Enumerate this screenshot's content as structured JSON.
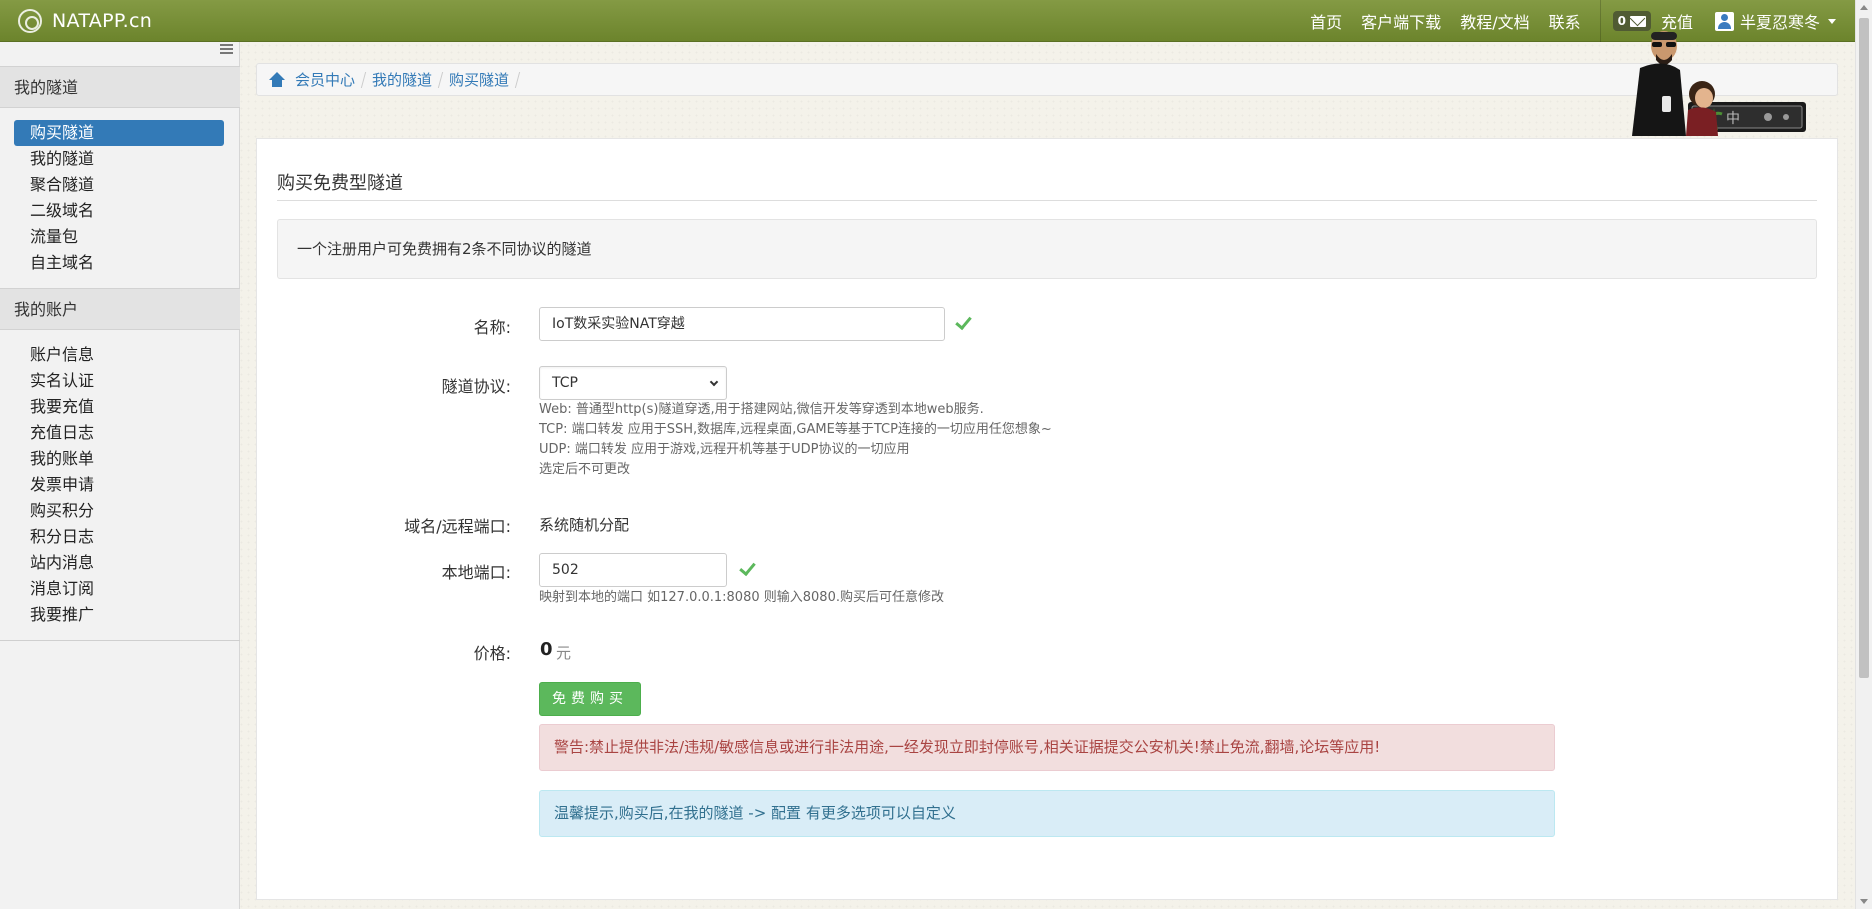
{
  "navbar": {
    "brand": "NATAPP.cn",
    "links": [
      "首页",
      "客户端下载",
      "教程/文档",
      "联系"
    ],
    "message_count": "0",
    "recharge_label": "充值",
    "username": "半夏忍寒冬",
    "bar_color": "#7a9235"
  },
  "sidebar": {
    "groups": [
      {
        "title": "我的隧道",
        "items": [
          "购买隧道",
          "我的隧道",
          "聚合隧道",
          "二级域名",
          "流量包",
          "自主域名"
        ],
        "active_index": 0
      },
      {
        "title": "我的账户",
        "items": [
          "账户信息",
          "实名认证",
          "我要充值",
          "充值日志",
          "我的账单",
          "发票申请",
          "购买积分",
          "积分日志",
          "站内消息",
          "消息订阅",
          "我要推广"
        ]
      }
    ]
  },
  "breadcrumb": [
    "会员中心",
    "我的隧道",
    "购买隧道"
  ],
  "form": {
    "title": "购买免费型隧道",
    "notice": "一个注册用户可免费拥有2条不同协议的隧道",
    "name_label": "名称:",
    "name_value": "IoT数采实验NAT穿越",
    "protocol_label": "隧道协议:",
    "protocol_value": "TCP",
    "protocol_help": [
      "Web: 普通型http(s)隧道穿透,用于搭建网站,微信开发等穿透到本地web服务.",
      "TCP: 端口转发 应用于SSH,数据库,远程桌面,GAME等基于TCP连接的一切应用任您想象~",
      "UDP: 端口转发 应用于游戏,远程开机等基于UDP协议的一切应用",
      "选定后不可更改"
    ],
    "domain_label": "域名/远程端口:",
    "domain_value": "系统随机分配",
    "local_port_label": "本地端口:",
    "local_port_value": "502",
    "local_port_help": "映射到本地的端口 如127.0.0.1:8080 则输入8080.购买后可任意修改",
    "price_label": "价格:",
    "price_value": "0",
    "price_unit": "元",
    "buy_button": "免费购买",
    "warning": "警告:禁止提供非法/违规/敏感信息或进行非法用途,一经发现立即封停账号,相关证据提交公安机关!禁止免流,翻墙,论坛等应用!",
    "tip": "温馨提示,购买后,在我的隧道 -> 配置 有更多选项可以自定义"
  },
  "mascot": {
    "sign_text": "中"
  },
  "colors": {
    "primary": "#337ab7",
    "success": "#5cb85c",
    "danger_text": "#a94442",
    "info_text": "#31708f"
  }
}
